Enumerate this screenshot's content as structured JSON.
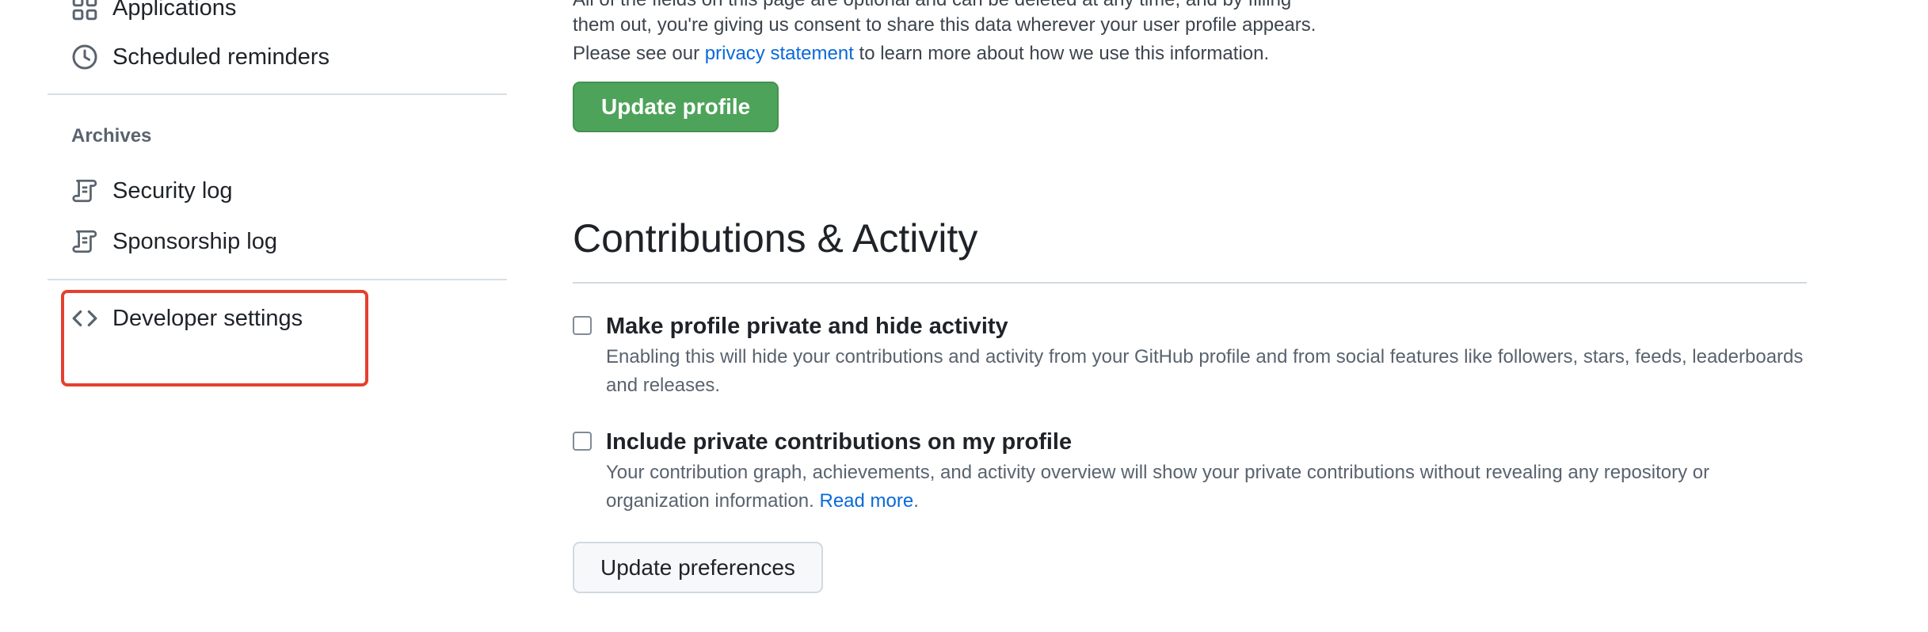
{
  "sidebar": {
    "items_top": [
      {
        "label": "Applications",
        "icon": "apps-icon"
      },
      {
        "label": "Scheduled reminders",
        "icon": "clock-icon"
      }
    ],
    "archives_heading": "Archives",
    "archive_items": [
      {
        "label": "Security log",
        "icon": "log-icon"
      },
      {
        "label": "Sponsorship log",
        "icon": "log-icon"
      }
    ],
    "developer_settings": {
      "label": "Developer settings",
      "icon": "code-icon"
    }
  },
  "main": {
    "intro": {
      "line1": "All of the fields on this page are optional and can be deleted at any time, and by filling",
      "line2": "them out, you're giving us consent to share this data wherever your user profile appears.",
      "line3_prefix": "Please see our ",
      "line3_link": "privacy statement",
      "line3_suffix": " to learn more about how we use this information."
    },
    "update_profile_label": "Update profile",
    "contributions": {
      "title": "Contributions & Activity",
      "options": [
        {
          "label": "Make profile private and hide activity",
          "checked": false,
          "description": "Enabling this will hide your contributions and activity from your GitHub profile and from social features like followers, stars, feeds, leaderboards and releases."
        },
        {
          "label": "Include private contributions on my profile",
          "checked": false,
          "description": "Your contribution graph, achievements, and activity overview will show your private contributions without revealing any repository or organization information. ",
          "link": "Read more",
          "link_suffix": "."
        }
      ],
      "update_preferences_label": "Update preferences"
    }
  },
  "colors": {
    "primary_button": "#4ea35a",
    "link": "#0969da",
    "highlight": "#e5402f"
  }
}
